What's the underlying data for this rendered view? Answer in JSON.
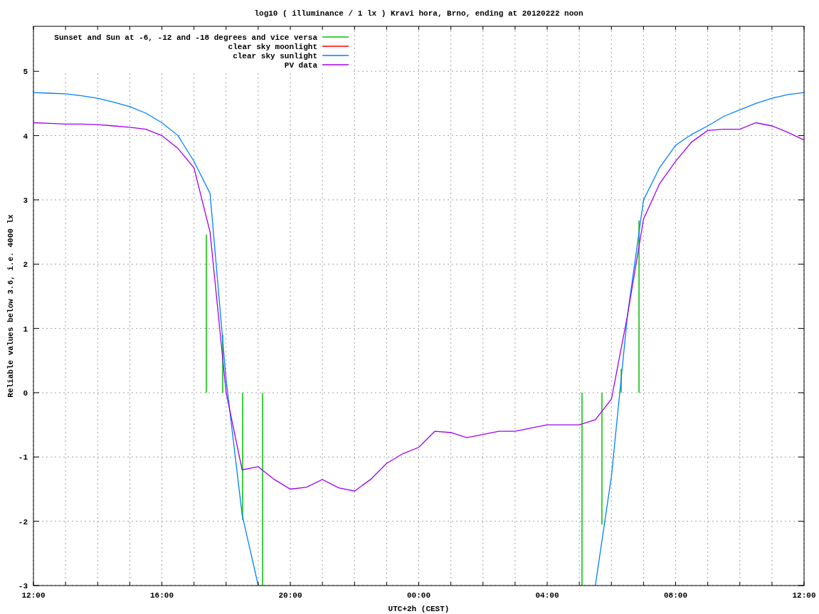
{
  "chart_data": {
    "type": "line",
    "title": "log10 ( illuminance / 1 lx ) Kravi hora, Brno, ending at 20120222 noon",
    "xlabel": "UTC+2h (CEST)",
    "ylabel": "Reliable values below 3.6, i.e. 4000 lx",
    "ylim": [
      -3,
      5.7
    ],
    "grid": true,
    "legend": true,
    "categories": [
      "12:00",
      null,
      null,
      null,
      null,
      null,
      null,
      null,
      "16:00",
      null,
      null,
      null,
      null,
      null,
      null,
      null,
      "20:00",
      null,
      null,
      null,
      null,
      null,
      null,
      null,
      "00:00",
      null,
      null,
      null,
      null,
      null,
      null,
      null,
      "04:00",
      null,
      null,
      null,
      null,
      null,
      null,
      null,
      "08:00",
      null,
      null,
      null,
      null,
      null,
      null,
      null,
      "12:00"
    ],
    "yticks": [
      -3,
      -2,
      -1,
      0,
      1,
      2,
      3,
      4,
      5
    ],
    "series": [
      {
        "name": "Sunset and Sun at -6, -12 and -18 degrees and vice versa",
        "color": "#00c000",
        "values": [
          null,
          null,
          null,
          null,
          null,
          null,
          null,
          null,
          null,
          null,
          null,
          null,
          null,
          null,
          null,
          null,
          null,
          null,
          null,
          null,
          null,
          null,
          null,
          null,
          null,
          null,
          null,
          null,
          null,
          null,
          null,
          null,
          null,
          null,
          null,
          null,
          null,
          null,
          null,
          null,
          null,
          null,
          null,
          null,
          null,
          null,
          null,
          null,
          null
        ]
      },
      {
        "name": "clear sky moonlight",
        "color": "#ff0000",
        "values": [
          null,
          null,
          null,
          null,
          null,
          null,
          null,
          null,
          null,
          null,
          null,
          null,
          null,
          null,
          null,
          null,
          null,
          null,
          null,
          null,
          null,
          null,
          null,
          null,
          null,
          null,
          null,
          null,
          null,
          null,
          null,
          null,
          null,
          null,
          null,
          null,
          null,
          null,
          null,
          null,
          null,
          null,
          null,
          null,
          null,
          null,
          null,
          null,
          null
        ]
      },
      {
        "name": "clear sky sunlight",
        "color": "#0080ff",
        "values": [
          4.67,
          4.66,
          4.65,
          4.62,
          4.58,
          4.52,
          4.45,
          4.35,
          4.2,
          4.0,
          3.6,
          3.1,
          0.2,
          -1.9,
          -3.0,
          null,
          null,
          null,
          null,
          null,
          null,
          null,
          null,
          null,
          null,
          null,
          null,
          null,
          null,
          null,
          null,
          null,
          null,
          null,
          null,
          -3.0,
          -1.3,
          1.2,
          3.0,
          3.5,
          3.85,
          4.02,
          4.15,
          4.3,
          4.4,
          4.5,
          4.58,
          4.64,
          4.67
        ]
      },
      {
        "name": "PV data",
        "color": "#a000f0",
        "values": [
          4.2,
          4.19,
          4.18,
          4.18,
          4.17,
          4.15,
          4.13,
          4.1,
          4.0,
          3.8,
          3.5,
          2.5,
          0.0,
          -1.2,
          -1.15,
          -1.35,
          -1.5,
          -1.47,
          -1.35,
          -1.48,
          -1.53,
          -1.35,
          -1.1,
          -0.95,
          -0.85,
          -0.6,
          -0.62,
          -0.7,
          -0.65,
          -0.6,
          -0.6,
          -0.55,
          -0.5,
          -0.5,
          -0.5,
          -0.42,
          -0.1,
          1.2,
          2.7,
          3.25,
          3.6,
          3.9,
          4.08,
          4.1,
          4.1,
          4.2,
          4.15,
          4.05,
          3.93
        ]
      }
    ]
  }
}
